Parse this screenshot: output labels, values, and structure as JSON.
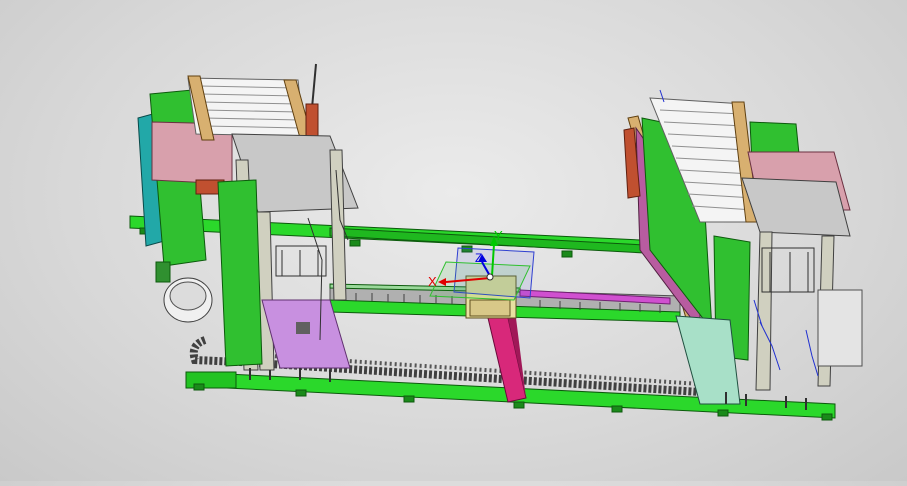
{
  "viewport": {
    "triad": {
      "x_label": "X",
      "y_label": "Y",
      "z_label": "Z"
    }
  },
  "colors": {
    "background": "#dcdcdc",
    "frame_green": "#2bd82b",
    "frame_green_dark": "#149414",
    "magenta": "#d8287a",
    "pink": "#d8a0ac",
    "teal": "#22a8a8",
    "purple": "#c890e0",
    "tan": "#d8b070",
    "gray_plate": "#c8c8c8",
    "axis_x": "#e00000",
    "axis_y": "#00c800",
    "axis_z": "#0000e0"
  }
}
